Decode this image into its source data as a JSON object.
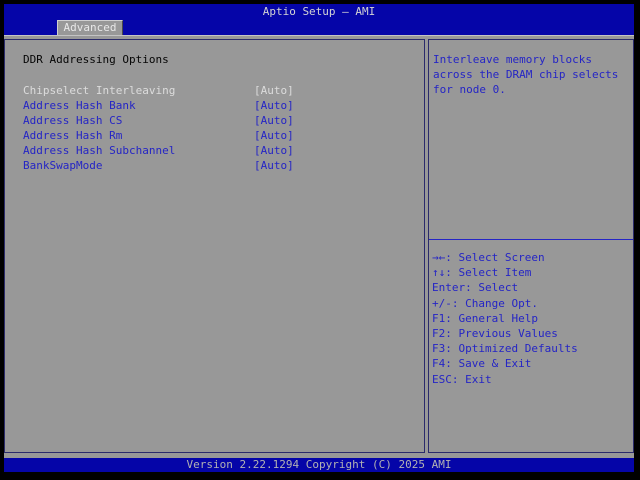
{
  "header": {
    "title": "Aptio Setup – AMI"
  },
  "tabs": {
    "advanced": {
      "label": "Advanced",
      "active": true
    }
  },
  "main": {
    "section_title": "DDR Addressing Options",
    "items": [
      {
        "label": "Chipselect Interleaving",
        "value": "[Auto]",
        "selected": true
      },
      {
        "label": "Address Hash Bank",
        "value": "[Auto]",
        "selected": false
      },
      {
        "label": "Address Hash CS",
        "value": "[Auto]",
        "selected": false
      },
      {
        "label": "Address Hash Rm",
        "value": "[Auto]",
        "selected": false
      },
      {
        "label": "Address Hash Subchannel",
        "value": "[Auto]",
        "selected": false
      },
      {
        "label": "BankSwapMode",
        "value": "[Auto]",
        "selected": false
      }
    ]
  },
  "help": {
    "text": "Interleave memory blocks across the DRAM chip selects for node 0."
  },
  "legend": [
    {
      "keys": "→←",
      "action": "Select Screen"
    },
    {
      "keys": "↑↓",
      "action": "Select Item"
    },
    {
      "keys": "Enter",
      "action": "Select"
    },
    {
      "keys": "+/-",
      "action": "Change Opt."
    },
    {
      "keys": "F1",
      "action": "General Help"
    },
    {
      "keys": "F2",
      "action": "Previous Values"
    },
    {
      "keys": "F3",
      "action": "Optimized Defaults"
    },
    {
      "keys": "F4",
      "action": "Save & Exit"
    },
    {
      "keys": "ESC",
      "action": "Exit"
    }
  ],
  "footer": {
    "version_text": "Version 2.22.1294 Copyright (C) 2025 AMI"
  },
  "colors": {
    "bar_blue": "#0505a8",
    "background_gray": "#989898",
    "panel_border_navy": "#2b2b6b",
    "item_blue": "#2525c5",
    "selected_text": "#dcdcdc",
    "frame_black": "#000000"
  }
}
